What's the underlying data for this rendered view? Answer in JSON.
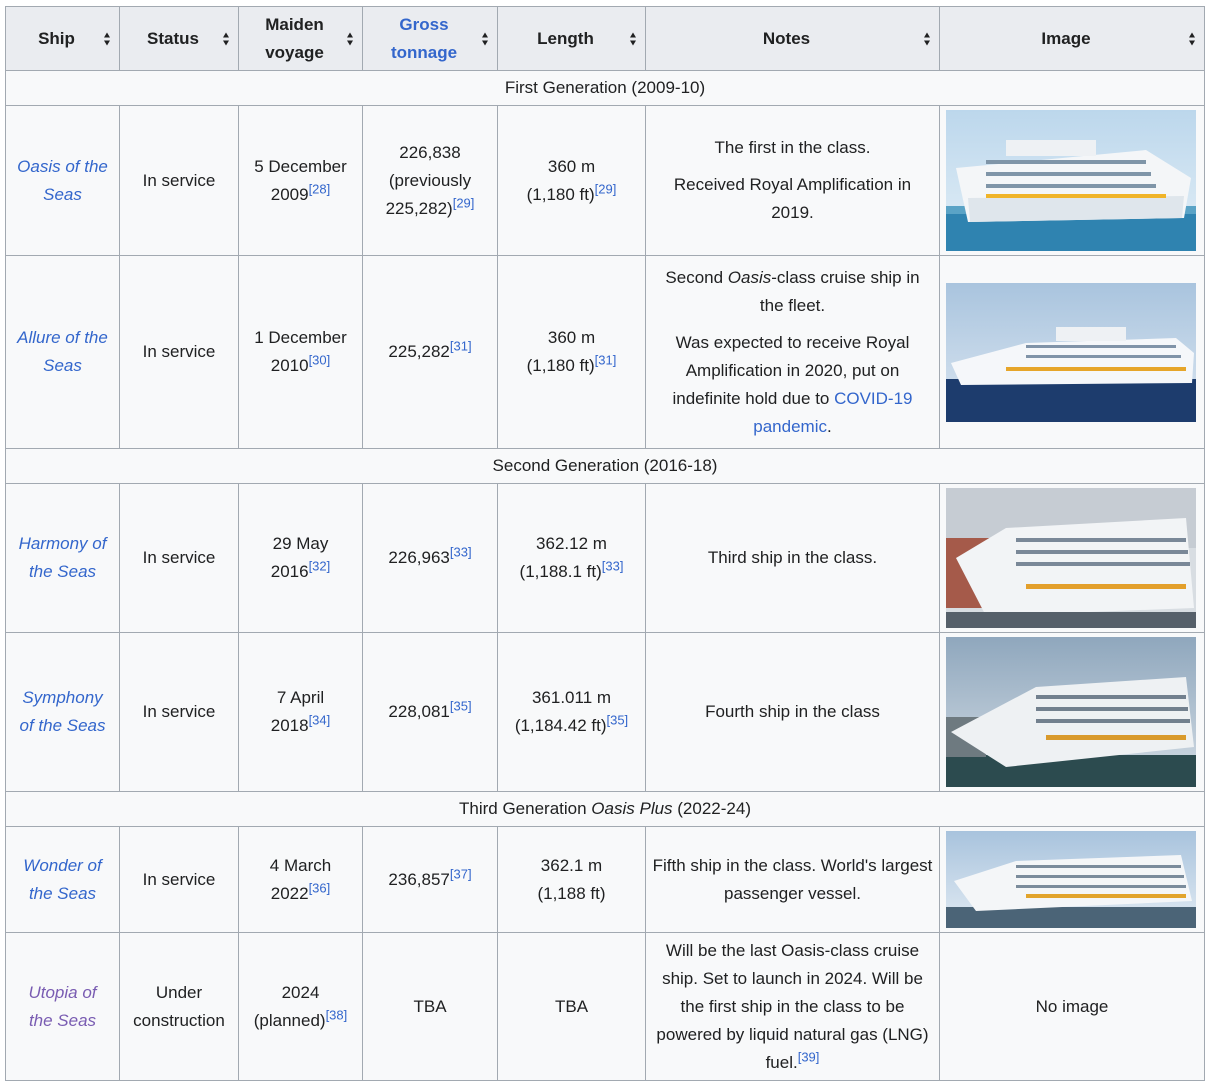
{
  "headers": {
    "ship": "Ship",
    "status": "Status",
    "maiden_line1": "Maiden",
    "maiden_line2": "voyage",
    "gross_line1": "Gross",
    "gross_line2": "tonnage",
    "length": "Length",
    "notes": "Notes",
    "image": "Image"
  },
  "generations": [
    {
      "label": "First Generation (2009-10)"
    },
    {
      "label": "Second Generation (2016-18)"
    },
    {
      "label_before": "Third Generation ",
      "label_italic": "Oasis Plus",
      "label_after": " (2022-24)"
    }
  ],
  "ships": [
    {
      "name_line1": "Oasis of the",
      "name_line2": "Seas",
      "status": "In service",
      "maiden_line1": "5 December",
      "maiden_line2": "2009",
      "maiden_ref": "[28]",
      "gross_line1": "226,838",
      "gross_line2": "(previously",
      "gross_line3": "225,282)",
      "gross_ref": "[29]",
      "length_line1": "360 m",
      "length_line2": "(1,180 ft)",
      "length_ref": "[29]",
      "notes_p1": "The first in the class.",
      "notes_p2": "Received Royal Amplification in 2019."
    },
    {
      "name_line1": "Allure of the",
      "name_line2": "Seas",
      "status": "In service",
      "maiden_line1": "1 December",
      "maiden_line2": "2010",
      "maiden_ref": "[30]",
      "gross": "225,282",
      "gross_ref": "[31]",
      "length_line1": "360 m",
      "length_line2": "(1,180 ft)",
      "length_ref": "[31]",
      "notes_p1_before": "Second ",
      "notes_p1_italic": "Oasis",
      "notes_p1_after": "-class cruise ship in the fleet.",
      "notes_p2_text": "Was expected to receive Royal Amplification in 2020, put on indefinite hold due to ",
      "notes_p2_link": "COVID-19 pandemic",
      "notes_p2_end": "."
    },
    {
      "name_line1": "Harmony of",
      "name_line2": "the Seas",
      "status": "In service",
      "maiden_line1": "29 May",
      "maiden_line2": "2016",
      "maiden_ref": "[32]",
      "gross": "226,963",
      "gross_ref": "[33]",
      "length_line1": "362.12 m",
      "length_line2": "(1,188.1 ft)",
      "length_ref": "[33]",
      "notes": "Third ship in the class."
    },
    {
      "name_line1": "Symphony",
      "name_line2": "of the Seas",
      "status": "In service",
      "maiden_line1": "7 April",
      "maiden_line2": "2018",
      "maiden_ref": "[34]",
      "gross": "228,081",
      "gross_ref": "[35]",
      "length_line1": "361.011 m",
      "length_line2": "(1,184.42 ft)",
      "length_ref": "[35]",
      "notes": "Fourth ship in the class"
    },
    {
      "name_line1": "Wonder of",
      "name_line2": "the Seas",
      "status": "In service",
      "maiden_line1": "4 March",
      "maiden_line2": "2022",
      "maiden_ref": "[36]",
      "gross": "236,857",
      "gross_ref": "[37]",
      "length_line1": "362.1 m",
      "length_line2": "(1,188 ft)",
      "notes": "Fifth ship in the class. World's largest passenger vessel."
    },
    {
      "name_line1": "Utopia of",
      "name_line2": "the Seas",
      "status_line1": "Under",
      "status_line2": "construction",
      "maiden_line1": "2024",
      "maiden_line2": "(planned)",
      "maiden_ref": "[38]",
      "gross": "TBA",
      "length": "TBA",
      "notes": "Will be the last Oasis-class cruise ship. Set to launch in 2024. Will be the first ship in the class to be powered by liquid natural gas (LNG) fuel.",
      "notes_ref": "[39]",
      "image": "No image"
    }
  ],
  "colors": {
    "link": "#3366cc",
    "visited_link": "#795cb2",
    "header_bg": "#eaecf0",
    "cell_bg": "#f8f9fa",
    "border": "#a2a9b1"
  }
}
